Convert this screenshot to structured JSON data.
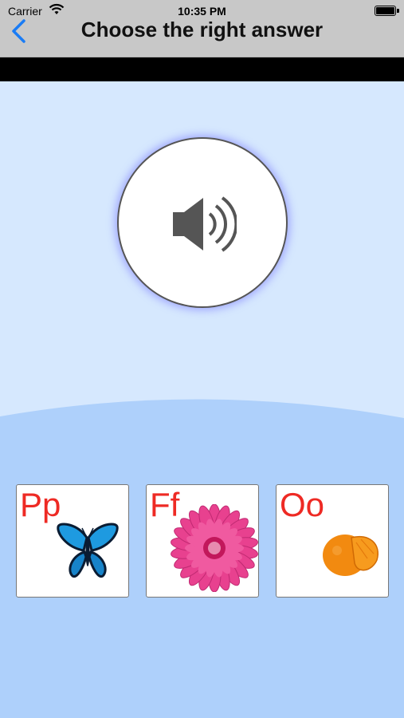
{
  "status_bar": {
    "carrier": "Carrier",
    "time": "10:35 PM"
  },
  "header": {
    "title": "Choose the right answer"
  },
  "icons": {
    "back": "chevron-left-icon",
    "sound": "speaker-volume-icon"
  },
  "colors": {
    "nav_bg": "#c8c8c8",
    "page_bg": "#d6e8fe",
    "bottom_bg": "#aed0fb",
    "letter": "#ee2a24",
    "back": "#1a7cf5"
  },
  "answers": [
    {
      "letters": "Pp",
      "picture": "butterfly"
    },
    {
      "letters": "Ff",
      "picture": "flower"
    },
    {
      "letters": "Oo",
      "picture": "orange"
    }
  ]
}
